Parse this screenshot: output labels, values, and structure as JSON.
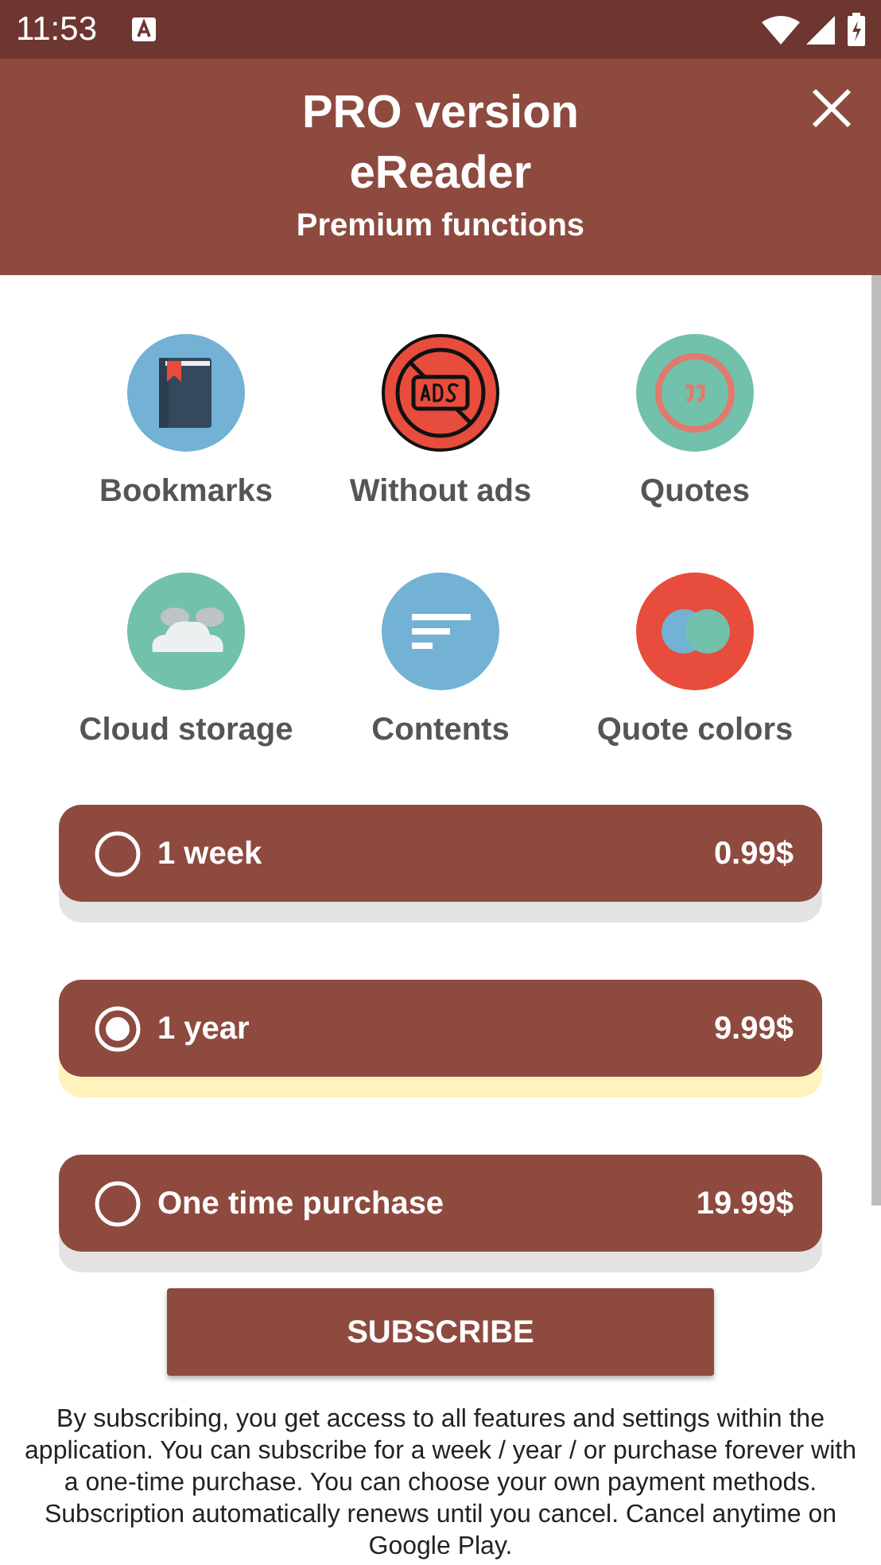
{
  "status_bar": {
    "time": "11:53"
  },
  "header": {
    "title": "PRO version",
    "app_name": "eReader",
    "subtitle": "Premium functions"
  },
  "features": [
    {
      "label": "Bookmarks"
    },
    {
      "label": "Without ads"
    },
    {
      "label": "Quotes"
    },
    {
      "label": "Cloud storage"
    },
    {
      "label": "Contents"
    },
    {
      "label": "Quote colors"
    }
  ],
  "plans": [
    {
      "name": "1 week",
      "price": "0.99$",
      "selected": false
    },
    {
      "name": "1 year",
      "price": "9.99$",
      "selected": true
    },
    {
      "name": "One time purchase",
      "price": "19.99$",
      "selected": false
    }
  ],
  "subscribe_button": "SUBSCRIBE",
  "disclaimer": "By subscribing, you get access to all features and settings within the application. You can subscribe for a week / year / or purchase forever with a one-time purchase. You can choose your own payment methods. Subscription automatically renews until you cancel. Cancel anytime on Google Play."
}
